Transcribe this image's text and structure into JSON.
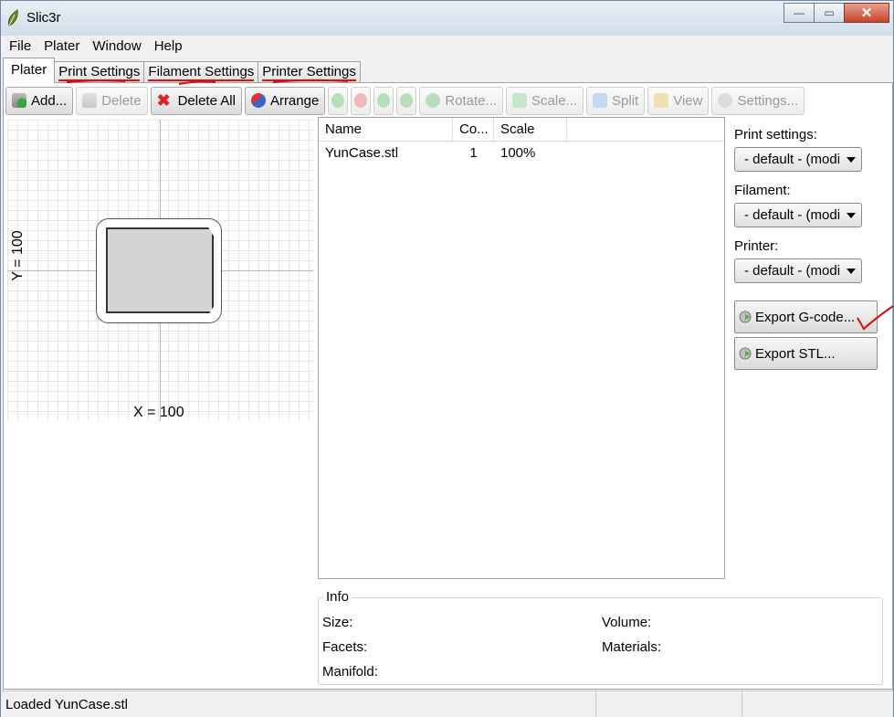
{
  "window": {
    "title": "Slic3r",
    "minimize_glyph": "—",
    "maximize_glyph": "▭",
    "close_glyph": "✕"
  },
  "menu": [
    "File",
    "Plater",
    "Window",
    "Help"
  ],
  "tabs": [
    {
      "label": "Plater",
      "active": true
    },
    {
      "label": "Print Settings",
      "active": false
    },
    {
      "label": "Filament Settings",
      "active": false
    },
    {
      "label": "Printer Settings",
      "active": false
    }
  ],
  "toolbar": {
    "add": "Add...",
    "delete": "Delete",
    "delete_all": "Delete All",
    "arrange": "Arrange",
    "rotate": "Rotate...",
    "scale": "Scale...",
    "split": "Split",
    "view": "View",
    "settings": "Settings..."
  },
  "plate": {
    "x_label": "X = 100",
    "y_label": "Y = 100"
  },
  "object_list": {
    "columns": [
      "Name",
      "Co...",
      "Scale"
    ],
    "rows": [
      {
        "name": "YunCase.stl",
        "copies": "1",
        "scale": "100%"
      }
    ]
  },
  "side": {
    "print_label": "Print settings:",
    "print_value": "- default - (modi",
    "filament_label": "Filament:",
    "filament_value": "- default - (modi",
    "printer_label": "Printer:",
    "printer_value": "- default - (modi",
    "export_gcode": "Export G-code...",
    "export_stl": "Export STL..."
  },
  "info": {
    "legend": "Info",
    "size": "Size:",
    "volume": "Volume:",
    "facets": "Facets:",
    "materials": "Materials:",
    "manifold": "Manifold:"
  },
  "status": {
    "text": "Loaded YunCase.stl"
  },
  "colors": {
    "annotation_red": "#d11111",
    "accent_green": "#4caf50"
  }
}
